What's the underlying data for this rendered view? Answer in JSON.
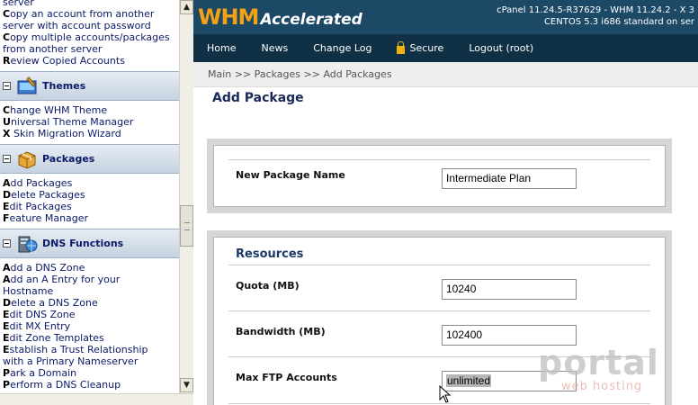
{
  "sidebar": {
    "top_links": [
      {
        "first": "",
        "rest": "server"
      },
      {
        "first": "C",
        "rest": "opy an account from another"
      },
      {
        "first": "",
        "rest": "server with account password"
      },
      {
        "first": "C",
        "rest": "opy multiple accounts/packages"
      },
      {
        "first": "",
        "rest": "from another server"
      },
      {
        "first": "R",
        "rest": "eview Copied Accounts"
      }
    ],
    "themes": {
      "title": "Themes",
      "links": [
        {
          "first": "C",
          "rest": "hange WHM Theme"
        },
        {
          "first": "U",
          "rest": "niversal Theme Manager"
        },
        {
          "first": "X",
          "rest": " Skin Migration Wizard"
        }
      ]
    },
    "packages": {
      "title": "Packages",
      "links": [
        {
          "first": "A",
          "rest": "dd Packages"
        },
        {
          "first": "D",
          "rest": "elete Packages"
        },
        {
          "first": "E",
          "rest": "dit Packages"
        },
        {
          "first": "F",
          "rest": "eature Manager"
        }
      ]
    },
    "dns": {
      "title": "DNS Functions",
      "links": [
        {
          "first": "A",
          "rest": "dd a DNS Zone"
        },
        {
          "first": "A",
          "rest": "dd an A Entry for your"
        },
        {
          "first": "",
          "rest": "Hostname"
        },
        {
          "first": "D",
          "rest": "elete a DNS Zone"
        },
        {
          "first": "E",
          "rest": "dit DNS Zone"
        },
        {
          "first": "E",
          "rest": "dit MX Entry"
        },
        {
          "first": "E",
          "rest": "dit Zone Templates"
        },
        {
          "first": "E",
          "rest": "stablish a Trust Relationship"
        },
        {
          "first": "",
          "rest": "with a Primary Nameserver"
        },
        {
          "first": "P",
          "rest": "ark a Domain"
        },
        {
          "first": "P",
          "rest": "erform a DNS Cleanup"
        }
      ]
    }
  },
  "header": {
    "logo_whm": "WHM",
    "logo_accelerated": "Accelerated",
    "server_line1": "cPanel 11.24.5-R37629 - WHM 11.24.2 - X 3",
    "server_line2": "CENTOS 5.3 i686 standard on ser"
  },
  "nav": {
    "home": "Home",
    "news": "News",
    "changelog": "Change Log",
    "secure": "Secure",
    "logout": "Logout (root)"
  },
  "breadcrumb": "Main >> Packages >> Add Packages",
  "page_title": "Add Package",
  "form": {
    "package_name_label": "New Package Name",
    "package_name_value": "Intermediate Plan",
    "resources_heading": "Resources",
    "quota_label": "Quota (MB)",
    "quota_value": "10240",
    "bandwidth_label": "Bandwidth (MB)",
    "bandwidth_value": "102400",
    "ftp_label": "Max FTP Accounts",
    "ftp_value": "unlimited"
  },
  "watermark": {
    "big": "portal",
    "small": "web hosting"
  },
  "scrollbar": {
    "up": "▲",
    "down": "▼"
  },
  "colors": {
    "header_bg": "#1c4966",
    "nav_bg": "#0f3045",
    "logo_orange": "#f4a213"
  }
}
